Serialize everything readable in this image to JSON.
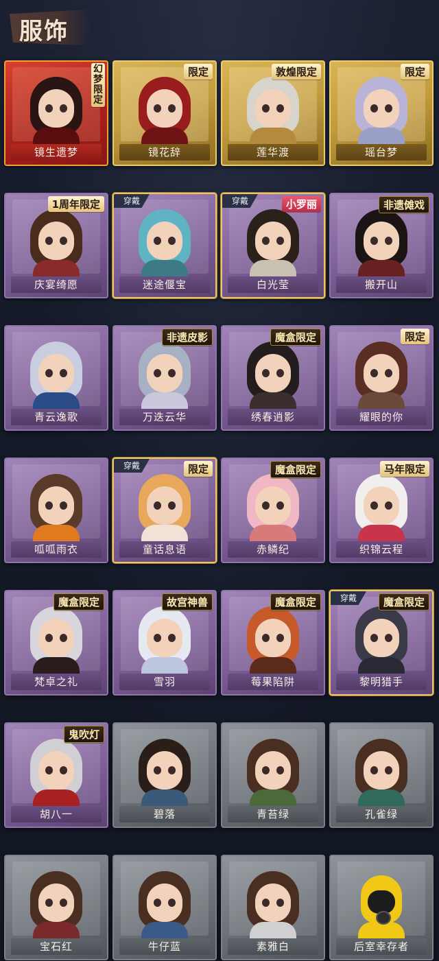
{
  "header": {
    "title": "服饰"
  },
  "colors": {
    "background": "#141826",
    "accent_gold": "#e9c46a"
  },
  "cards": [
    {
      "name": "镜生遗梦",
      "rarity": "red",
      "badge": "幻梦限定",
      "badge_style": "vertical",
      "equipped": false,
      "hair": "#2a1414",
      "body": "#5a0d0d"
    },
    {
      "name": "镜花辞",
      "rarity": "gold",
      "badge": "限定",
      "badge_style": "normal",
      "equipped": false,
      "hair": "#9a1d1d",
      "body": "#6e1414"
    },
    {
      "name": "莲华渡",
      "rarity": "gold",
      "badge": "敦煌限定",
      "badge_style": "normal",
      "equipped": false,
      "hair": "#d7d4cc",
      "body": "#b58a3d"
    },
    {
      "name": "瑶台梦",
      "rarity": "gold",
      "badge": "限定",
      "badge_style": "normal",
      "equipped": false,
      "hair": "#b9b3d8",
      "body": "#9aa0c8"
    },
    {
      "name": "庆宴绮愿",
      "rarity": "purple",
      "badge": "1周年限定",
      "badge_style": "normal",
      "equipped": false,
      "hair": "#4a2c1c",
      "body": "#8a2a2a"
    },
    {
      "name": "迷途偃宝",
      "rarity": "purple",
      "badge": "",
      "badge_style": "normal",
      "equipped": true,
      "equipped_label": "穿戴",
      "hair": "#5fb4c4",
      "body": "#3c7a86"
    },
    {
      "name": "白光莹",
      "rarity": "purple",
      "badge": "小罗丽",
      "badge_style": "red",
      "equipped": true,
      "equipped_label": "穿戴",
      "hair": "#2b211b",
      "body": "#c9c2b3"
    },
    {
      "name": "搬开山",
      "rarity": "purple",
      "badge": "非遗傩戏",
      "badge_style": "dark",
      "equipped": false,
      "hair": "#1a1414",
      "body": "#6a2020"
    },
    {
      "name": "青云逸歌",
      "rarity": "purple",
      "badge": "",
      "badge_style": "normal",
      "equipped": false,
      "hair": "#c8cde0",
      "body": "#2a4c86"
    },
    {
      "name": "万迭云华",
      "rarity": "purple",
      "badge": "非遗皮影",
      "badge_style": "dark",
      "equipped": false,
      "hair": "#a8b0c4",
      "body": "#c9c8dc"
    },
    {
      "name": "绣春逍影",
      "rarity": "purple",
      "badge": "魔盒限定",
      "badge_style": "dark",
      "equipped": false,
      "hair": "#241d1d",
      "body": "#3a2e2e"
    },
    {
      "name": "耀眼的你",
      "rarity": "purple",
      "badge": "限定",
      "badge_style": "normal",
      "equipped": false,
      "hair": "#5a2e22",
      "body": "#6a4a3a"
    },
    {
      "name": "呱呱雨衣",
      "rarity": "purple",
      "badge": "",
      "badge_style": "normal",
      "equipped": false,
      "hair": "#5a3a28",
      "body": "#e07a1f"
    },
    {
      "name": "童话息语",
      "rarity": "purple",
      "badge": "限定",
      "badge_style": "normal",
      "equipped": true,
      "equipped_label": "穿戴",
      "hair": "#e7a85c",
      "body": "#f2e2d6"
    },
    {
      "name": "赤鳞纪",
      "rarity": "purple",
      "badge": "魔盒限定",
      "badge_style": "dark",
      "equipped": false,
      "hair": "#f0b7c4",
      "body": "#d87a7a"
    },
    {
      "name": "织锦云程",
      "rarity": "purple",
      "badge": "马年限定",
      "badge_style": "normal",
      "equipped": false,
      "hair": "#f1eeee",
      "body": "#c8344a"
    },
    {
      "name": "梵卓之礼",
      "rarity": "purple",
      "badge": "魔盒限定",
      "badge_style": "dark",
      "equipped": false,
      "hair": "#d8d6dc",
      "body": "#2a1c1c"
    },
    {
      "name": "雪羽",
      "rarity": "purple",
      "badge": "故宫神兽",
      "badge_style": "dark",
      "equipped": false,
      "hair": "#e6e8f2",
      "body": "#bcc6dc"
    },
    {
      "name": "莓果陷阱",
      "rarity": "purple",
      "badge": "魔盒限定",
      "badge_style": "dark",
      "equipped": false,
      "hair": "#c65a2a",
      "body": "#5a2a1a"
    },
    {
      "name": "黎明猎手",
      "rarity": "purple",
      "badge": "魔盒限定",
      "badge_style": "dark",
      "equipped": true,
      "equipped_label": "穿戴",
      "hair": "#3a3a48",
      "body": "#2a2a36"
    },
    {
      "name": "胡八一",
      "rarity": "purple",
      "badge": "鬼吹灯",
      "badge_style": "dark",
      "equipped": false,
      "hair": "#cfcfd4",
      "body": "#a82020"
    },
    {
      "name": "碧落",
      "rarity": "gray",
      "badge": "",
      "badge_style": "normal",
      "equipped": false,
      "hair": "#2a1e18",
      "body": "#3a5a7a"
    },
    {
      "name": "青苔绿",
      "rarity": "gray",
      "badge": "",
      "badge_style": "normal",
      "equipped": false,
      "hair": "#4a2e22",
      "body": "#4a6a3a"
    },
    {
      "name": "孔雀绿",
      "rarity": "gray",
      "badge": "",
      "badge_style": "normal",
      "equipped": false,
      "hair": "#4a2e22",
      "body": "#2f6a5a"
    },
    {
      "name": "宝石红",
      "rarity": "gray",
      "badge": "",
      "badge_style": "normal",
      "equipped": false,
      "hair": "#4a2e22",
      "body": "#7a2a2a"
    },
    {
      "name": "牛仔蓝",
      "rarity": "gray",
      "badge": "",
      "badge_style": "normal",
      "equipped": false,
      "hair": "#4a2e22",
      "body": "#3a5a8a"
    },
    {
      "name": "素雅白",
      "rarity": "gray",
      "badge": "",
      "badge_style": "normal",
      "equipped": false,
      "hair": "#4a2e22",
      "body": "#d0d0d0"
    },
    {
      "name": "后室幸存者",
      "rarity": "gray",
      "badge": "",
      "badge_style": "normal",
      "equipped": false,
      "special": "gasmask",
      "hair": "#f1c816",
      "body": "#f1c816"
    }
  ]
}
